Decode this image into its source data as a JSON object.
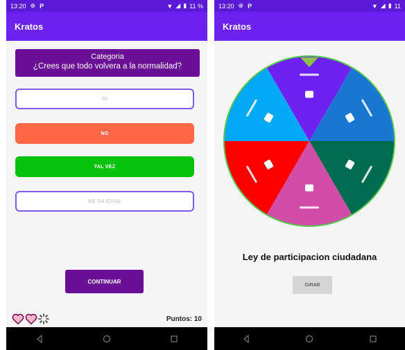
{
  "left_screen": {
    "status": {
      "time": "13:20",
      "battery": "11 %"
    },
    "app_title": "Kratos",
    "question": {
      "category": "Categoria",
      "text": "¿Crees que todo volvera a la normalidad?"
    },
    "answers": [
      {
        "label": "SI",
        "style": "outlined"
      },
      {
        "label": "NO",
        "style": "red"
      },
      {
        "label": "TAL VEZ",
        "style": "green"
      },
      {
        "label": "ME DA IGUAL",
        "style": "outlined"
      }
    ],
    "continue_label": "CONTINUAR",
    "points_label": "Puntos: 10",
    "lives_icons": [
      "heart-icon",
      "heart-icon",
      "spinner-icon"
    ]
  },
  "right_screen": {
    "status": {
      "time": "13:20",
      "battery": "11"
    },
    "app_title": "Kratos",
    "wheel": {
      "segments": [
        {
          "color": "#6d22f2",
          "icon": "category-icon"
        },
        {
          "color": "#1976d2",
          "icon": "category-icon"
        },
        {
          "color": "#006b4f",
          "icon": "category-icon"
        },
        {
          "color": "#d24da8",
          "icon": "category-icon"
        },
        {
          "color": "#ff0000",
          "icon": "category-icon"
        },
        {
          "color": "#03a9f4",
          "icon": "category-icon"
        }
      ],
      "border_color": "#56c850",
      "pointer_color": "#8bc34a"
    },
    "topic": "Ley de participacion ciudadana",
    "spin_label": "GIRAR"
  },
  "colors": {
    "primary": "#6d22f2",
    "status_bar": "#5a1ad8",
    "dark_purple": "#6a0f95"
  }
}
